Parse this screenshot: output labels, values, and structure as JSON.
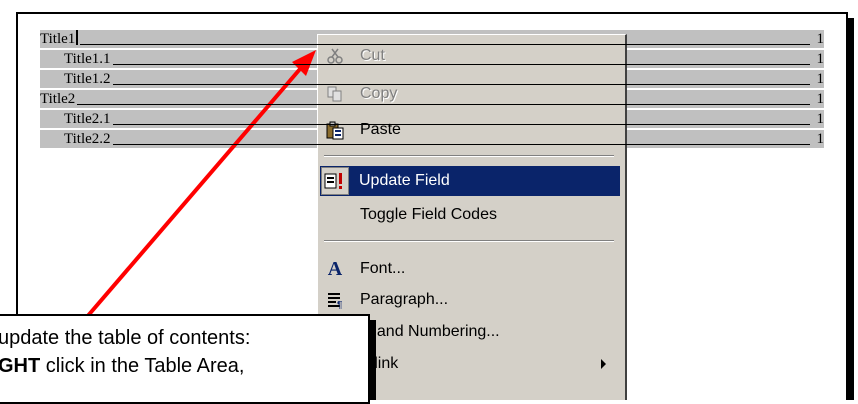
{
  "toc": {
    "rows": [
      {
        "title": "Title1",
        "page": "1",
        "indent": 0,
        "cursor": true
      },
      {
        "title": "Title1.1",
        "page": "1",
        "indent": 1
      },
      {
        "title": "Title1.2",
        "page": "1",
        "indent": 1
      },
      {
        "title": "Title2",
        "page": "1",
        "indent": 0
      },
      {
        "title": "Title2.1",
        "page": "1",
        "indent": 1
      },
      {
        "title": "Title2.2",
        "page": "1",
        "indent": 1
      }
    ]
  },
  "context_menu": {
    "items": {
      "cut": {
        "label": "Cut",
        "icon": "scissors-icon",
        "disabled": true
      },
      "copy": {
        "label": "Copy",
        "icon": "copy-icon",
        "disabled": true
      },
      "paste": {
        "label": "Paste",
        "icon": "clipboard-icon",
        "disabled": false
      },
      "update_field": {
        "label": "Update Field",
        "icon": "update-field-icon",
        "selected": true
      },
      "toggle_field_codes": {
        "label": "Toggle Field Codes"
      },
      "font": {
        "label": "Font...",
        "icon": "font-icon"
      },
      "paragraph": {
        "label": "Paragraph...",
        "icon": "paragraph-icon"
      },
      "bullets": {
        "label_partial": "ts and Numbering..."
      },
      "hyperlink": {
        "label_partial": "erlink",
        "has_submenu": true
      }
    }
  },
  "callout": {
    "line1": "update the table of contents:",
    "line2_bold": "GHT",
    "line2_rest": " click in the Table Area,"
  },
  "colors": {
    "highlight": "#0a246a",
    "menu_bg": "#d4d0c8",
    "field_shade": "#c0c0c0",
    "arrow": "#ff0000"
  }
}
